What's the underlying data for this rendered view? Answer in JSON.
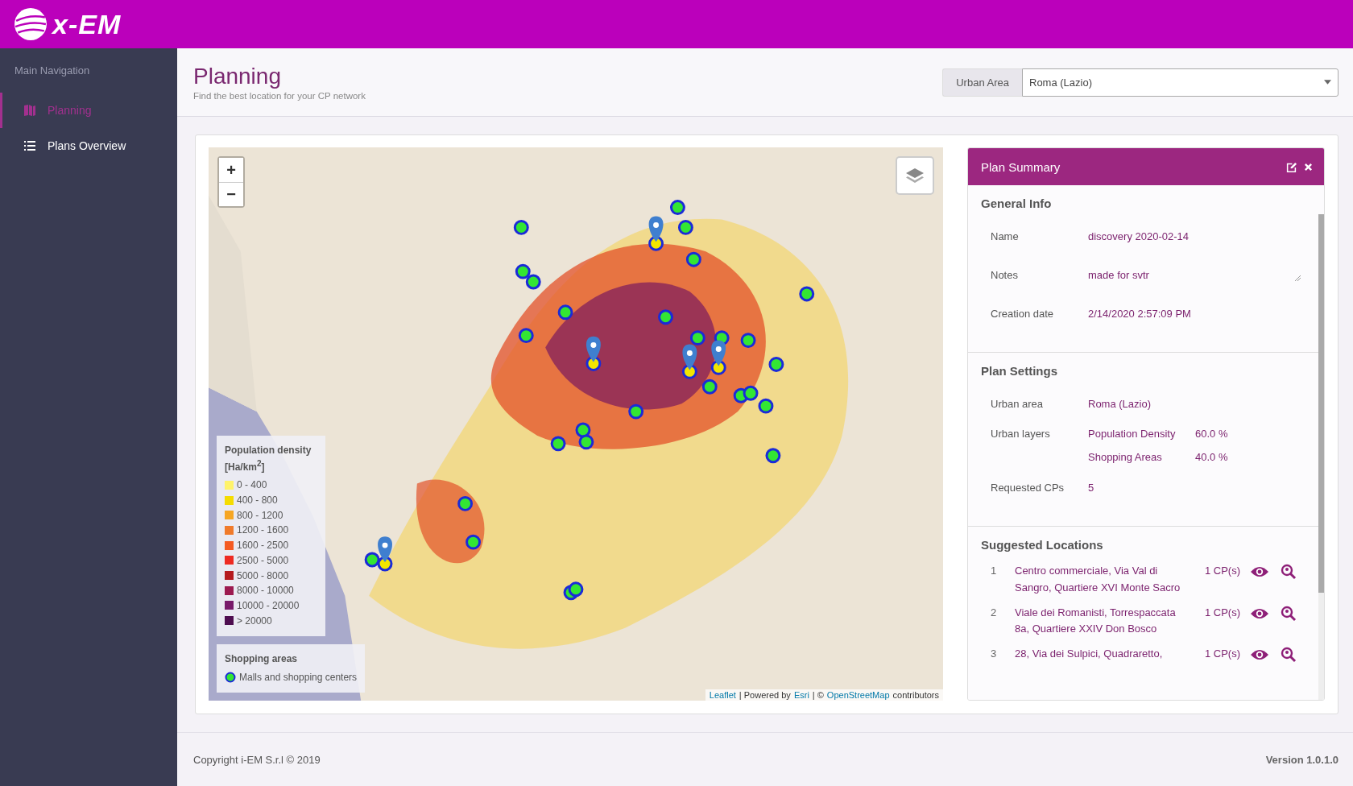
{
  "app": {
    "logo_text": "x-EM"
  },
  "sidebar": {
    "heading": "Main Navigation",
    "items": [
      {
        "label": "Planning",
        "kind": "planning",
        "selected": true
      },
      {
        "label": "Plans Overview",
        "kind": "list",
        "selected": false
      }
    ]
  },
  "page": {
    "title": "Planning",
    "subtitle": "Find the best location for your CP network"
  },
  "urban_area": {
    "label": "Urban Area",
    "value": "Roma (Lazio)"
  },
  "map": {
    "zoom_in": "+",
    "zoom_out": "−",
    "legend": {
      "title": "Population density [Ha/km$^{2}$]",
      "items": [
        {
          "label": "0 - 400",
          "color": "#fff36b"
        },
        {
          "label": "400 - 800",
          "color": "#f5dc00"
        },
        {
          "label": "800 - 1200",
          "color": "#f6a623"
        },
        {
          "label": "1200 - 1600",
          "color": "#f07a2a"
        },
        {
          "label": "1600 - 2500",
          "color": "#f45a22"
        },
        {
          "label": "2500 - 5000",
          "color": "#ee2a22"
        },
        {
          "label": "5000 - 8000",
          "color": "#b51a1e"
        },
        {
          "label": "8000 - 10000",
          "color": "#9c1a50"
        },
        {
          "label": "10000 - 20000",
          "color": "#781a6a"
        },
        {
          "label": "> 20000",
          "color": "#4e0d50"
        }
      ]
    },
    "shopping_legend": {
      "title": "Shopping areas",
      "item": "Malls and shopping centers"
    },
    "attribution": [
      {
        "kind": "link",
        "text": "Leaflet"
      },
      {
        "kind": "text",
        "text": "| Powered by"
      },
      {
        "kind": "link",
        "text": "Esri"
      },
      {
        "kind": "text",
        "text": "| ©"
      },
      {
        "kind": "link",
        "text": "OpenStreetMap"
      },
      {
        "kind": "text",
        "text": "contributors"
      }
    ]
  },
  "plan_summary": {
    "title": "Plan Summary",
    "general_info": {
      "heading": "General Info",
      "fields": [
        {
          "label": "Name",
          "value": "discovery 2020-02-14",
          "kind": "text"
        },
        {
          "label": "Notes",
          "value": "made for svtr",
          "kind": "textarea"
        },
        {
          "label": "Creation date",
          "value": "2/14/2020 2:57:09 PM",
          "kind": "text"
        }
      ]
    },
    "plan_settings": {
      "heading": "Plan Settings",
      "urban_area": {
        "label": "Urban area",
        "value": "Roma (Lazio)"
      },
      "urban_layers": {
        "label": "Urban layers",
        "layers": [
          {
            "name": "Population Density",
            "share": "60.0 %"
          },
          {
            "name": "Shopping Areas",
            "share": "40.0 %"
          }
        ]
      },
      "requested_cps": {
        "label": "Requested CPs",
        "value": "5"
      }
    },
    "suggested_locations": {
      "heading": "Suggested Locations",
      "items": [
        {
          "index": "1",
          "address": "Centro commerciale, Via Val di Sangro, Quartiere XVI Monte Sacro",
          "count": "1 CP(s)"
        },
        {
          "index": "2",
          "address": "Viale dei Romanisti, Torrespaccata 8a, Quartiere XXIV Don Bosco",
          "count": "1 CP(s)"
        },
        {
          "index": "3",
          "address": "28, Via dei Sulpici, Quadraretto,",
          "count": "1 CP(s)"
        }
      ]
    }
  },
  "footer": {
    "copyright": "Copyright i-EM S.r.l © 2019",
    "version": "Version 1.0.1.0"
  }
}
